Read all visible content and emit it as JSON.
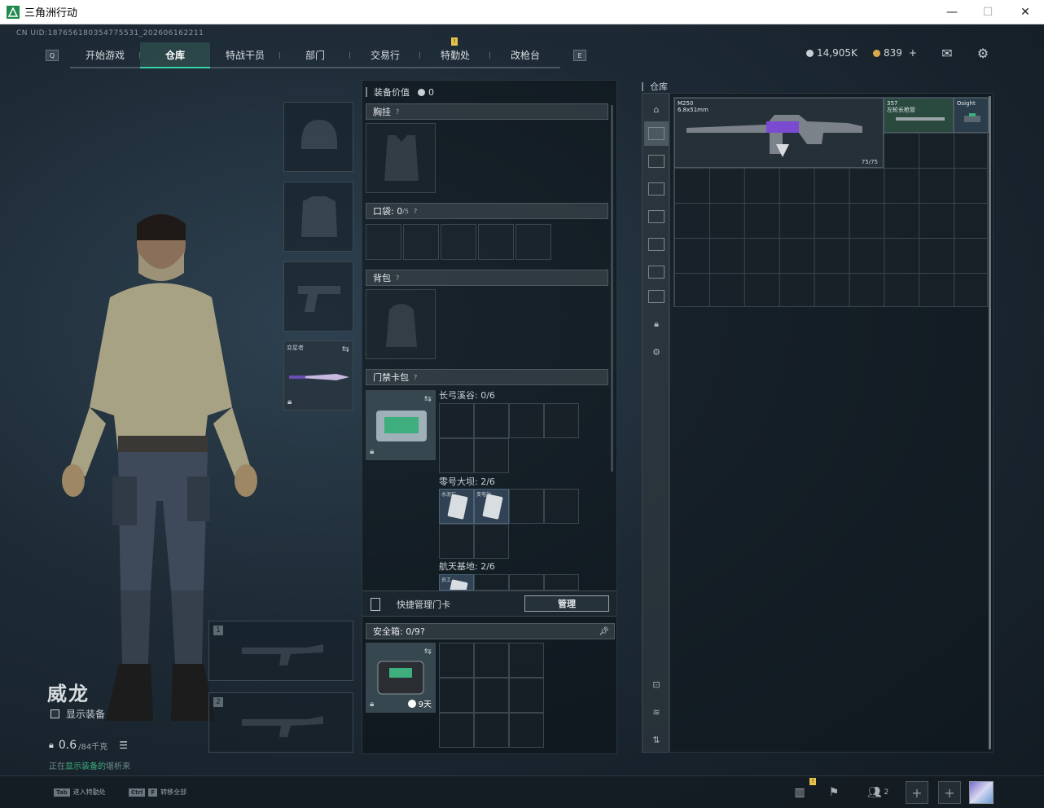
{
  "window": {
    "title": "三角洲行动"
  },
  "uid": "CN UID:187656180354775531_202606162211",
  "nav": {
    "tabs": [
      {
        "label": "开始游戏",
        "active": false
      },
      {
        "label": "仓库",
        "active": true
      },
      {
        "label": "特战干员",
        "active": false
      },
      {
        "label": "部门",
        "active": false
      },
      {
        "label": "交易行",
        "active": false
      },
      {
        "label": "特勤处",
        "active": false,
        "badge": "!"
      },
      {
        "label": "改枪台",
        "active": false
      }
    ],
    "left_key": "Q",
    "right_key": "E"
  },
  "currency": {
    "silver": "14,905K",
    "gold": "839",
    "gold_add": "+"
  },
  "character": {
    "name": "威龙",
    "show_equipment_label": "显示装备",
    "weight": "0.6",
    "weight_max": "/84千克",
    "status_prefix": "正在",
    "status_highlight": "显示装备的",
    "status_suffix": "堪析来"
  },
  "slots": {
    "melee_label": "变星者",
    "weapon1_num": "1",
    "weapon2_num": "2"
  },
  "loadout": {
    "value_label": "装备价值",
    "value": "0",
    "chest_label": "胸挂",
    "pocket_label": "口袋:",
    "pocket_count": "0",
    "pocket_max": "/5",
    "backpack_label": "背包",
    "keycard_label": "门禁卡包",
    "maps": [
      {
        "label": "长弓溪谷: 0/6"
      },
      {
        "label": "零号大坝: 2/6",
        "cards": [
          "水泥厂",
          "变电站"
        ]
      },
      {
        "label": "航天基地: 2/6",
        "cards": [
          "员工"
        ]
      }
    ],
    "quick_card_label": "快捷管理门卡",
    "manage_button": "管理",
    "safe_label": "安全箱:",
    "safe_count": "0",
    "safe_max": "/9",
    "safe_days": "9天",
    "help": "?"
  },
  "warehouse": {
    "title": "仓库",
    "items": [
      {
        "name": "M250",
        "sub": "6.8x51mm",
        "ammo": "75/75"
      },
      {
        "name": "357",
        "sub": "左轮长枪管"
      },
      {
        "name": "Osight",
        "sub": ""
      }
    ]
  },
  "bottom": {
    "hints": [
      {
        "key": "Tab",
        "label": "进入特勤处"
      },
      {
        "key1": "Ctrl",
        "key2": "F",
        "label": "转移全部"
      }
    ],
    "party_count": "2",
    "badge": "!"
  }
}
